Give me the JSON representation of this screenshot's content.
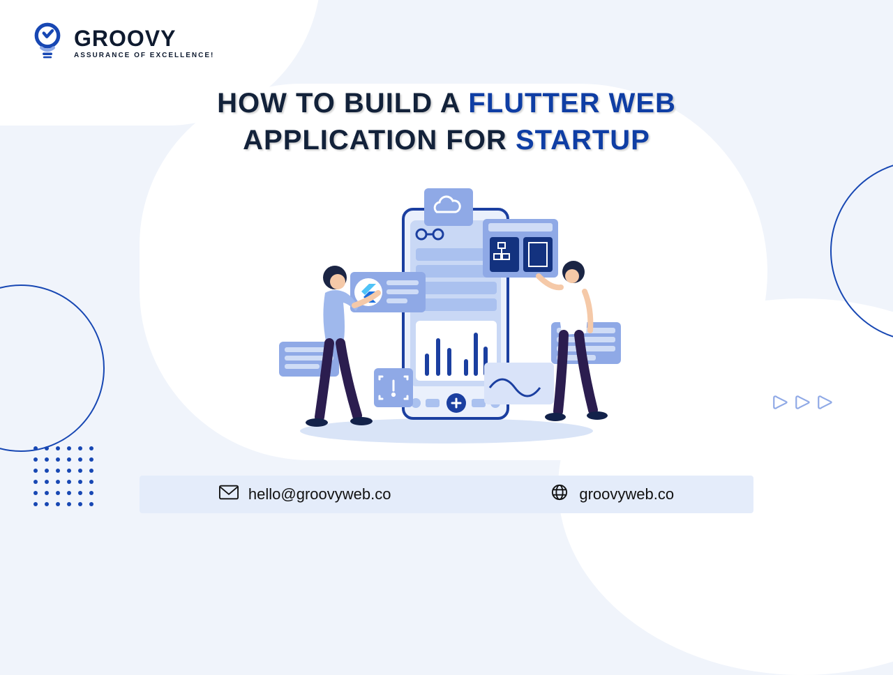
{
  "brand": {
    "name": "GROOVY",
    "tagline": "ASSURANCE OF EXCELLENCE!"
  },
  "title": {
    "p1": "HOW TO BUILD A ",
    "p2": "FLUTTER WEB",
    "p3": "APPLICATION FOR ",
    "p4": "STARTUP"
  },
  "contact": {
    "email": "hello@groovyweb.co",
    "website": "groovyweb.co"
  }
}
